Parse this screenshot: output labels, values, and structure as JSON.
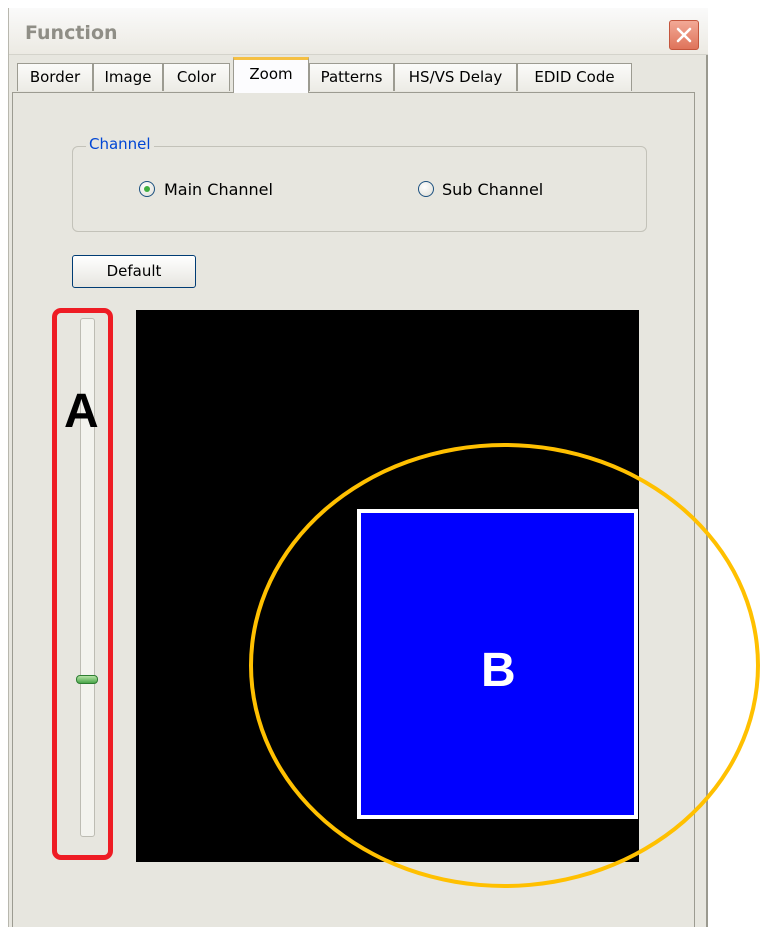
{
  "window": {
    "title": "Function"
  },
  "tabs": [
    {
      "label": "Border",
      "active": false
    },
    {
      "label": "Image",
      "active": false
    },
    {
      "label": "Color",
      "active": false
    },
    {
      "label": "Zoom",
      "active": true
    },
    {
      "label": "Patterns",
      "active": false
    },
    {
      "label": "HS/VS Delay",
      "active": false
    },
    {
      "label": "EDID Code",
      "active": false
    }
  ],
  "channel_group": {
    "legend": "Channel",
    "options": [
      {
        "label": "Main Channel",
        "selected": true
      },
      {
        "label": "Sub Channel",
        "selected": false
      }
    ]
  },
  "default_button": {
    "label": "Default"
  },
  "zoom_slider": {
    "orientation": "vertical",
    "position_fraction_from_top": 0.7
  },
  "annotations": {
    "a_label": "A",
    "b_label": "B",
    "a_color": "#ee1c24",
    "b_color": "#ffc000"
  },
  "preview": {
    "background_color": "#000000",
    "zoom_region_color": "#0000ff"
  },
  "icons": {
    "close": "close-icon"
  }
}
